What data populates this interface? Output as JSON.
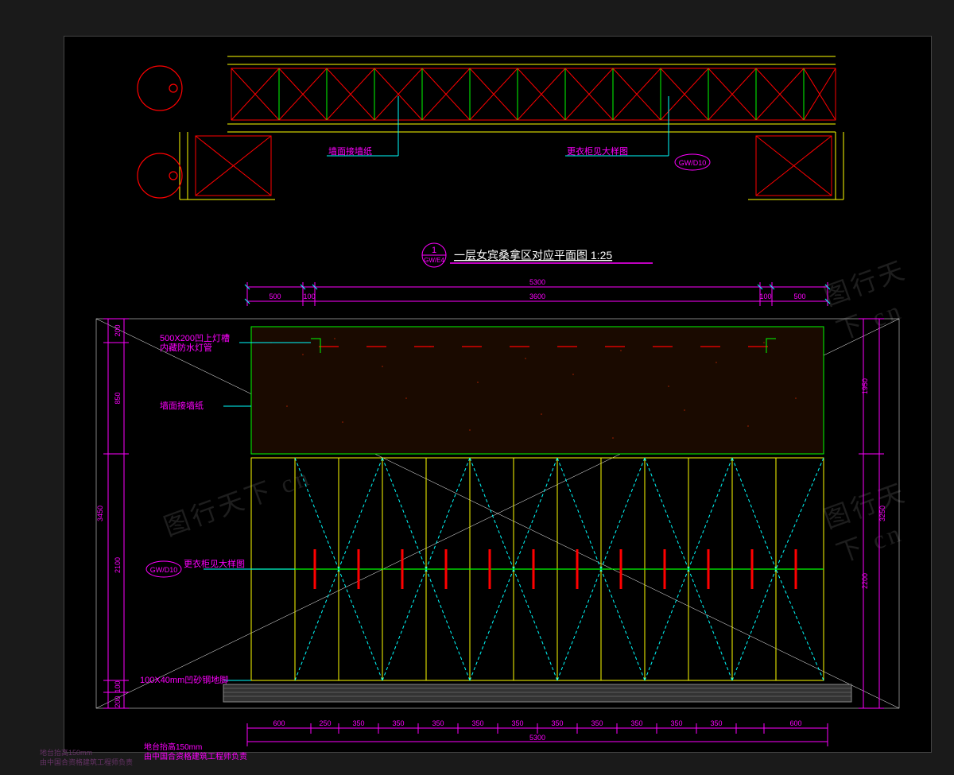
{
  "title": {
    "bubble_top": "1",
    "bubble_bottom": "GW/E4",
    "label": "一层女宾桑拿区对应平面图 1:25"
  },
  "plan_annotations": {
    "wall_paper": "墙面接墙纸",
    "locker_ref": "更衣柜见大样图",
    "locker_ref_tag": "GW/D10"
  },
  "elevation_annotations": {
    "light_trough": "500X200凹上灯槽\n内藏防水灯管",
    "wall_paper": "墙面接墙纸",
    "locker_ref": "更衣柜见大样图",
    "locker_ref_tag": "GW/D10",
    "skirting": "100X40mm凹砂钢地脚",
    "platform_note": "地台抬高150mm\n由中国合资格建筑工程师负责"
  },
  "dimensions": {
    "top_total": "5300",
    "top_segs": [
      "500",
      "100",
      "3600",
      "100",
      "500"
    ],
    "bottom_total": "5300",
    "bottom_segs": [
      "600",
      "250",
      "350",
      "350",
      "350",
      "350",
      "350",
      "350",
      "350",
      "350",
      "350",
      "350",
      "600"
    ],
    "left_outer": "3450",
    "left_segs_a": [
      "200",
      "100",
      "2100",
      "850",
      "200"
    ],
    "right_outer": "3250",
    "right_segs": [
      "1950",
      "2200"
    ]
  }
}
